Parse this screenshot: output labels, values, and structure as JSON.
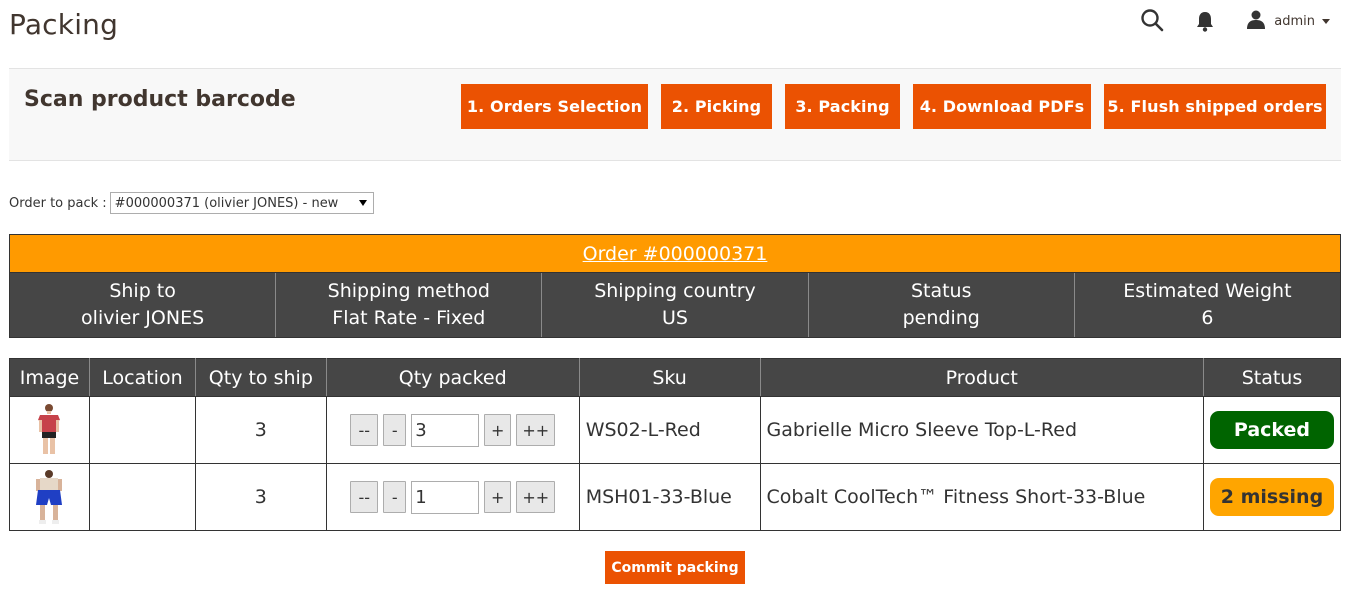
{
  "page": {
    "title": "Packing"
  },
  "topbar": {
    "search_icon": "search-icon",
    "notifications_icon": "bell-icon",
    "user_icon": "user-icon",
    "user_name": "admin"
  },
  "header": {
    "scan_title": "Scan product barcode",
    "steps": [
      {
        "label": "1. Orders Selection"
      },
      {
        "label": "2. Picking"
      },
      {
        "label": "3. Packing"
      },
      {
        "label": "4. Download PDFs"
      },
      {
        "label": "5. Flush shipped orders"
      }
    ],
    "accent_color": "#eb5202"
  },
  "order_select": {
    "label": "Order to pack :",
    "selected": "#000000371 (olivier JONES) - new"
  },
  "order": {
    "header": "Order #000000371",
    "header_color": "#ff9a00",
    "info": [
      {
        "label": "Ship to",
        "value": "olivier JONES"
      },
      {
        "label": "Shipping method",
        "value": "Flat Rate - Fixed"
      },
      {
        "label": "Shipping country",
        "value": "US"
      },
      {
        "label": "Status",
        "value": "pending"
      },
      {
        "label": "Estimated Weight",
        "value": "6"
      }
    ]
  },
  "items_table": {
    "columns": [
      "Image",
      "Location",
      "Qty to ship",
      "Qty packed",
      "Sku",
      "Product",
      "Status"
    ],
    "qty_buttons": {
      "dec_big": "--",
      "dec": "-",
      "inc": "+",
      "inc_big": "++"
    },
    "rows": [
      {
        "image": "red-tshirt-product-image",
        "location": "",
        "qty_to_ship": "3",
        "qty_packed": "3",
        "sku": "WS02-L-Red",
        "product": "Gabrielle Micro Sleeve Top-L-Red",
        "status": "Packed",
        "status_color": "#006400"
      },
      {
        "image": "blue-shorts-product-image",
        "location": "",
        "qty_to_ship": "3",
        "qty_packed": "1",
        "sku": "MSH01-33-Blue",
        "product": "Cobalt CoolTech™ Fitness Short-33-Blue",
        "status": "2 missing",
        "status_color": "#ffa500"
      }
    ]
  },
  "commit": {
    "label": "Commit packing"
  }
}
